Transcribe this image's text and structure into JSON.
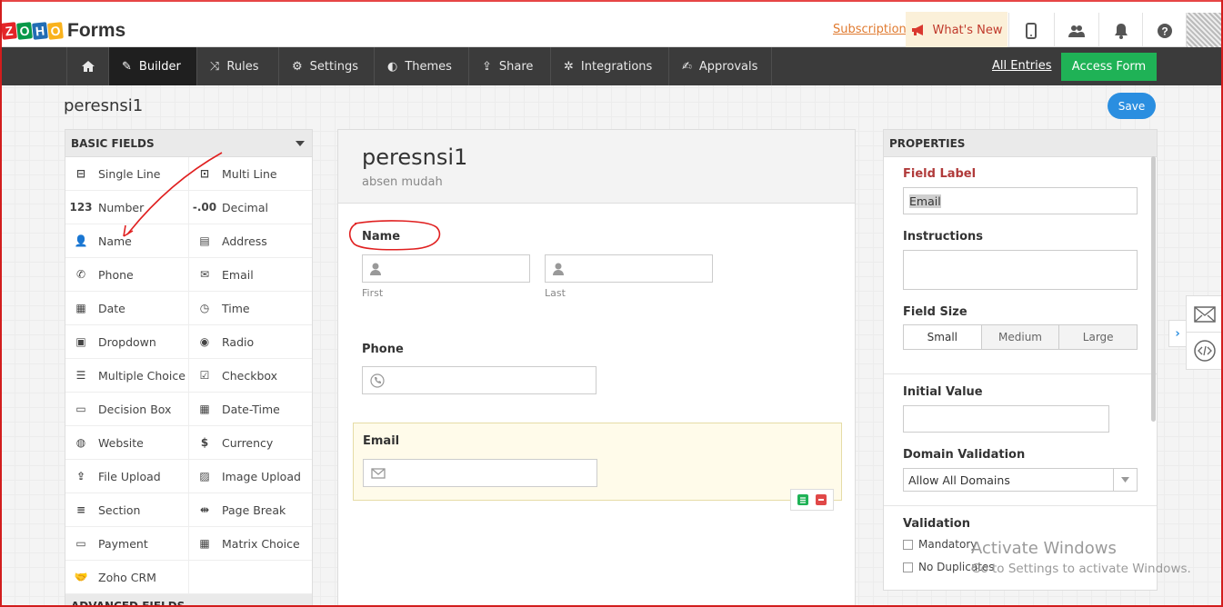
{
  "app": {
    "brand_letters": [
      "Z",
      "O",
      "H",
      "O"
    ],
    "brand_colors": [
      "#e42527",
      "#089949",
      "#226db4",
      "#f9b21d"
    ],
    "product": "Forms"
  },
  "topbar": {
    "subscription": "Subscription",
    "whats_new": "What's New"
  },
  "nav": {
    "items": [
      "Builder",
      "Rules",
      "Settings",
      "Themes",
      "Share",
      "Integrations",
      "Approvals"
    ],
    "active": "Builder",
    "all_entries": "All Entries",
    "access_form": "Access Form"
  },
  "form_name": "peresnsi1",
  "save_label": "Save",
  "basic_fields": {
    "title": "BASIC FIELDS",
    "items": [
      {
        "label": "Single Line",
        "icon": "single-line-icon"
      },
      {
        "label": "Multi Line",
        "icon": "multi-line-icon"
      },
      {
        "label": "Number",
        "icon": "number-icon"
      },
      {
        "label": "Decimal",
        "icon": "decimal-icon"
      },
      {
        "label": "Name",
        "icon": "person-icon"
      },
      {
        "label": "Address",
        "icon": "address-icon"
      },
      {
        "label": "Phone",
        "icon": "phone-icon"
      },
      {
        "label": "Email",
        "icon": "email-icon"
      },
      {
        "label": "Date",
        "icon": "calendar-icon"
      },
      {
        "label": "Time",
        "icon": "clock-icon"
      },
      {
        "label": "Dropdown",
        "icon": "dropdown-icon"
      },
      {
        "label": "Radio",
        "icon": "radio-icon"
      },
      {
        "label": "Multiple Choice",
        "icon": "multiple-choice-icon"
      },
      {
        "label": "Checkbox",
        "icon": "checkbox-icon"
      },
      {
        "label": "Decision Box",
        "icon": "decision-box-icon"
      },
      {
        "label": "Date-Time",
        "icon": "date-time-icon"
      },
      {
        "label": "Website",
        "icon": "globe-icon"
      },
      {
        "label": "Currency",
        "icon": "currency-icon"
      },
      {
        "label": "File Upload",
        "icon": "upload-icon"
      },
      {
        "label": "Image Upload",
        "icon": "image-icon"
      },
      {
        "label": "Section",
        "icon": "section-icon"
      },
      {
        "label": "Page Break",
        "icon": "page-break-icon"
      },
      {
        "label": "Payment",
        "icon": "payment-icon"
      },
      {
        "label": "Matrix Choice",
        "icon": "matrix-icon"
      },
      {
        "label": "Zoho CRM",
        "icon": "handshake-icon"
      },
      {
        "label": "",
        "icon": ""
      }
    ],
    "advanced_title": "ADVANCED FIELDS"
  },
  "glyphs": [
    "⊟",
    "⊡",
    "123",
    "-.00",
    "👤",
    "▤",
    "✆",
    "✉",
    "▦",
    "◷",
    "▣",
    "◉",
    "☰",
    "☑",
    "▭",
    "▦",
    "◍",
    "$",
    "⇪",
    "▨",
    "≡",
    "⇹",
    "▭",
    "▦",
    "🤝",
    ""
  ],
  "canvas": {
    "title": "peresnsi1",
    "description": "absen mudah",
    "fields": {
      "name": {
        "label": "Name",
        "first": "First",
        "last": "Last"
      },
      "phone": {
        "label": "Phone"
      },
      "email": {
        "label": "Email"
      }
    }
  },
  "properties": {
    "title": "PROPERTIES",
    "field_label": "Field Label",
    "field_label_value": "Email",
    "instructions": "Instructions",
    "field_size": "Field Size",
    "sizes": [
      "Small",
      "Medium",
      "Large"
    ],
    "selected_size": "Small",
    "initial_value": "Initial Value",
    "domain_validation": "Domain Validation",
    "domain_option": "Allow All Domains",
    "validation": "Validation",
    "checks": [
      "Mandatory",
      "No Duplicates"
    ]
  },
  "watermark": {
    "line1": "Activate Windows",
    "line2": "Go to Settings to activate Windows."
  },
  "colors": {
    "accent_green": "#1fb256",
    "accent_blue": "#2a8ee0",
    "field_label_red": "#b03a3a",
    "annotation_red": "#e02020"
  }
}
